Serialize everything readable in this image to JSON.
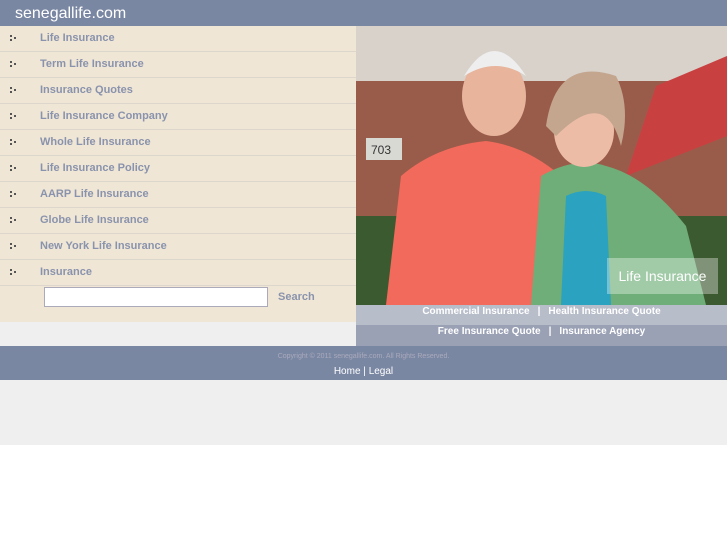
{
  "header": {
    "title": "senegallife.com"
  },
  "nav": {
    "items": [
      {
        "label": "Life Insurance"
      },
      {
        "label": "Term Life Insurance"
      },
      {
        "label": "Insurance Quotes"
      },
      {
        "label": "Life Insurance Company"
      },
      {
        "label": "Whole Life Insurance"
      },
      {
        "label": "Life Insurance Policy"
      },
      {
        "label": "AARP Life Insurance"
      },
      {
        "label": "Globe Life Insurance"
      },
      {
        "label": "New York Life Insurance"
      },
      {
        "label": "Insurance"
      }
    ]
  },
  "search": {
    "value": "",
    "button": "Search"
  },
  "photo": {
    "label": "Life Insurance",
    "house_number": "703"
  },
  "links_row1": [
    "Commercial Insurance",
    "Health Insurance Quote"
  ],
  "links_row2": [
    "Free Insurance Quote",
    "Insurance Agency"
  ],
  "separator": "|",
  "footer": {
    "copyright": "Copyright © 2011 senegallife.com. All Rights Reserved.",
    "home": "Home",
    "legal": "Legal",
    "sep": "|"
  },
  "colors": {
    "header": "#7a87a3",
    "panel": "#efe6d5",
    "link": "#8a93ad"
  }
}
